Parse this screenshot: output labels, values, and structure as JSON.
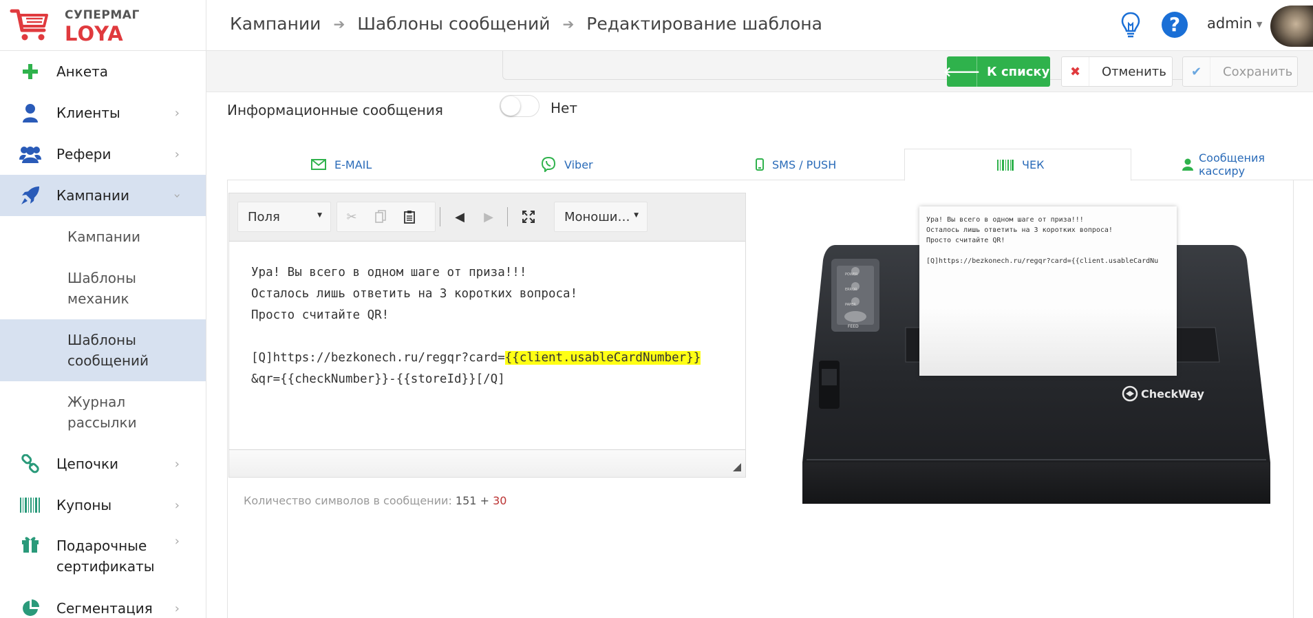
{
  "logo": {
    "top": "СУПЕРМАГ",
    "bottom": "LOYA"
  },
  "breadcrumb": [
    "Кампании",
    "Шаблоны сообщений",
    "Редактирование шаблона"
  ],
  "header": {
    "user": "admin"
  },
  "sidebar": {
    "items": [
      {
        "label": "Анкета",
        "icon": "plus-icon"
      },
      {
        "label": "Клиенты",
        "icon": "user-icon"
      },
      {
        "label": "Рефери",
        "icon": "users-icon"
      },
      {
        "label": "Кампании",
        "icon": "rocket-icon"
      },
      {
        "label": "Цепочки",
        "icon": "chain-icon"
      },
      {
        "label": "Купоны",
        "icon": "barcode-icon"
      },
      {
        "label": "Подарочные сертификаты",
        "icon": "gift-icon"
      },
      {
        "label": "Сегментация",
        "icon": "pie-icon"
      }
    ],
    "sub_items": [
      {
        "label": "Кампании"
      },
      {
        "label": "Шаблоны механик"
      },
      {
        "label": "Шаблоны сообщений"
      },
      {
        "label": "Журнал рассылки"
      }
    ]
  },
  "actions": {
    "back": "К списку",
    "cancel": "Отменить",
    "save": "Сохранить"
  },
  "info": {
    "label": "Информационные сообщения",
    "toggle_value": "Нет",
    "toggle_on": false
  },
  "tabs": [
    {
      "label": "E-MAIL",
      "icon": "envelope-icon"
    },
    {
      "label": "Viber",
      "icon": "viber-icon"
    },
    {
      "label": "SMS / PUSH",
      "icon": "mobile-icon"
    },
    {
      "label": "ЧЕК",
      "icon": "barcode-icon"
    },
    {
      "label": "Сообщения кассиру",
      "icon": "user-icon"
    }
  ],
  "editor": {
    "fields_select": "Поля",
    "font_select": "Моноши…",
    "lines": [
      "Ура! Вы всего в одном шаге от приза!!!",
      "Осталось лишь ответить на 3 коротких вопроса!",
      "Просто считайте QR!",
      "",
      "[Q]https://bezkonech.ru/regqr?card=",
      "{{client.usableCardNumber}}",
      "&qr={{checkNumber}}-{{storeId}}[/Q]"
    ]
  },
  "counter": {
    "label": "Количество символов в сообщении:",
    "count": "151",
    "plus": "+",
    "extra": "30"
  },
  "receipt": {
    "lines": [
      "Ура! Вы всего в одном шаге от приза!!!",
      "Осталось лишь ответить на 3 коротких вопроса!",
      "Просто считайте QR!",
      "",
      "[Q]https://bezkonech.ru/regqr?card={{client.usableCardNu"
    ],
    "brand": "CheckWay",
    "buttons": [
      "POWER",
      "ERROR",
      "PAPER",
      "FEED"
    ]
  },
  "colors": {
    "accent": "#2fb24c",
    "brand_red": "#e03a3e",
    "active_nav": "#d7e1f0",
    "link": "#2a6bb8",
    "highlight": "#ffff14"
  }
}
